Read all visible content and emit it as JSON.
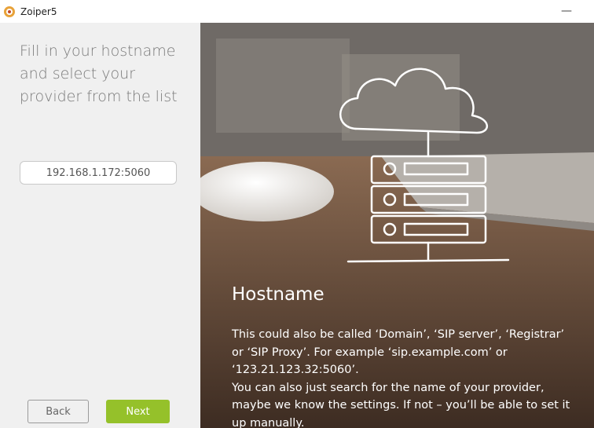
{
  "window": {
    "title": "Zoiper5",
    "minimize_glyph": "—"
  },
  "left_panel": {
    "heading": "Fill in your hostname and select your provider from the list",
    "hostname_value": "192.168.1.172:5060",
    "back_label": "Back",
    "next_label": "Next"
  },
  "info_panel": {
    "title": "Hostname",
    "paragraph1": " This could also be called ‘Domain’, ‘SIP server’, ‘Registrar’ or ‘SIP Proxy’. For example ‘sip.example.com’ or ‘123.21.123.32:5060’.",
    "paragraph2": "You can also just search for the name of your provider, maybe we know the settings. If not – you’ll be able to set it up manually."
  },
  "colors": {
    "accent": "#95c12a",
    "panel_bg": "#f0f0f0",
    "heading_text": "#7a7a7a"
  },
  "icons": {
    "app": "zoiper-logo-icon",
    "illustration": "cloud-server-icon"
  }
}
